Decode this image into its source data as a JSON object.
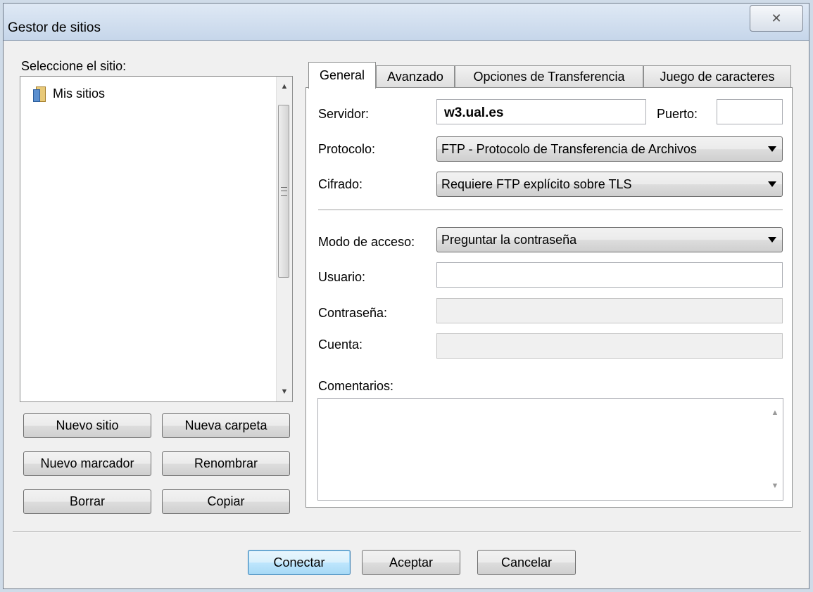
{
  "window": {
    "title": "Gestor de sitios",
    "close_glyph": "✕"
  },
  "sites": {
    "label": "Seleccione el sitio:",
    "root_item": "Mis sitios",
    "buttons": {
      "new_site": "Nuevo sitio",
      "new_folder": "Nueva carpeta",
      "new_bookmark": "Nuevo marcador",
      "rename": "Renombrar",
      "delete": "Borrar",
      "copy": "Copiar"
    }
  },
  "tabs": [
    "General",
    "Avanzado",
    "Opciones de Transferencia",
    "Juego de caracteres"
  ],
  "active_tab": "General",
  "general": {
    "server_label": "Servidor:",
    "server_value": "w3.ual.es",
    "port_label": "Puerto:",
    "port_value": "",
    "protocol_label": "Protocolo:",
    "protocol_value": "FTP - Protocolo de Transferencia de Archivos",
    "encryption_label": "Cifrado:",
    "encryption_value": "Requiere FTP explícito sobre TLS",
    "access_mode_label": "Modo de acceso:",
    "access_mode_value": "Preguntar la contraseña",
    "user_label": "Usuario:",
    "user_value": "",
    "password_label": "Contraseña:",
    "account_label": "Cuenta:",
    "comments_label": "Comentarios:"
  },
  "footer": {
    "connect": "Conectar",
    "accept": "Aceptar",
    "cancel": "Cancelar"
  },
  "colors": {
    "window_bg": "#f0f0f0",
    "default_button_border": "#3c7fb1"
  }
}
